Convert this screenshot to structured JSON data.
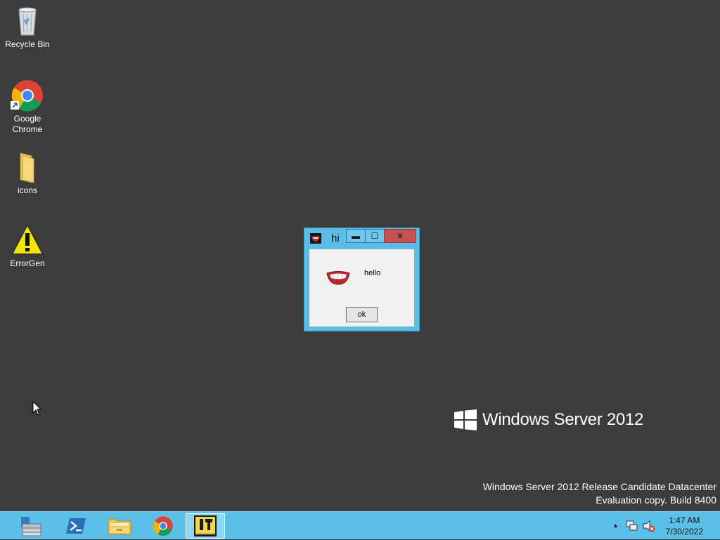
{
  "desktop": {
    "icons": [
      {
        "label": "Recycle Bin",
        "icon": "recycle-bin-icon"
      },
      {
        "label": "Google Chrome",
        "icon": "chrome-icon"
      },
      {
        "label": "icons",
        "icon": "folder-icon"
      },
      {
        "label": "ErrorGen",
        "icon": "warning-icon"
      }
    ]
  },
  "dialog": {
    "title": "hi",
    "message": "hello",
    "ok_label": "ok",
    "minimize_glyph": "▬",
    "maximize_glyph": "☐",
    "close_glyph": "✕"
  },
  "branding": {
    "product": "Windows Server 2012",
    "watermark_line1": "Windows Server 2012 Release Candidate Datacenter",
    "watermark_line2": "Evaluation copy. Build 8400"
  },
  "taskbar": {
    "apps": [
      {
        "name": "Server Manager",
        "icon": "server-manager-icon"
      },
      {
        "name": "PowerShell",
        "icon": "powershell-icon"
      },
      {
        "name": "File Explorer",
        "icon": "file-explorer-icon"
      },
      {
        "name": "Google Chrome",
        "icon": "chrome-icon"
      },
      {
        "name": "ErrorGen",
        "icon": "errorgen-app-icon"
      }
    ],
    "tray": {
      "show_hidden_glyph": "▲",
      "time": "1:47 AM",
      "date": "7/30/2022"
    }
  },
  "colors": {
    "desktop": "#3c3c3c",
    "taskbar": "#5bc0e8",
    "window_frame": "#5cbce6",
    "close_button": "#c75050"
  }
}
